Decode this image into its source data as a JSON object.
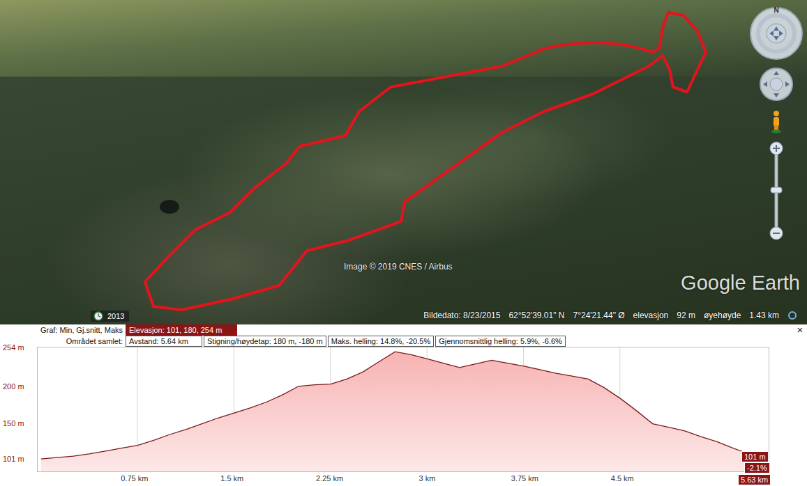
{
  "map": {
    "attribution": "Image © 2019 CNES / Airbus",
    "logo": "Google Earth",
    "compass": "N",
    "timeline_year": "2013",
    "status": {
      "image_date": "Bildedato: 8/23/2015",
      "lat": "62°52'39.01\" N",
      "lon": "7°24'21.44\" Ø",
      "elevation_label": "elevasjon",
      "elevation": "92 m",
      "eye_label": "øyehøyde",
      "eye_alt": "1.43 km"
    }
  },
  "profile_panel": {
    "close": "×",
    "graph_label": "Graf: Min, Gj.snitt, Maks",
    "elevation_summary": "Elevasjon: 101, 180, 254 m",
    "area_label": "Området samlet:",
    "stats": [
      "Avstand: 5.64 km",
      "Stigning/høydetap: 180 m, -180 m",
      "Maks. helling: 14.8%, -20.5%",
      "Gjennomsnittlig helling: 5.9%, -6.6%"
    ],
    "chart": {
      "km_max": 5.63,
      "y_ticks": [
        {
          "label": "254 m",
          "value": 254
        },
        {
          "label": "200 m",
          "value": 200
        },
        {
          "label": "150 m",
          "value": 150
        },
        {
          "label": "101 m",
          "value": 101
        }
      ],
      "x_ticks": [
        {
          "label": "0.75 km",
          "km": 0.75
        },
        {
          "label": "1.5 km",
          "km": 1.5
        },
        {
          "label": "2.25 km",
          "km": 2.25
        },
        {
          "label": "3 km",
          "km": 3
        },
        {
          "label": "3.75 km",
          "km": 3.75
        },
        {
          "label": "4.5 km",
          "km": 4.5
        }
      ],
      "series": [
        {
          "name": "Elevasjon",
          "values": [
            101,
            103,
            105,
            108,
            112,
            116,
            120,
            127,
            135,
            142,
            150,
            158,
            165,
            172,
            180,
            190,
            202,
            204,
            205,
            212,
            222,
            236,
            250,
            246,
            240,
            234,
            228,
            233,
            238,
            234,
            230,
            225,
            220,
            216,
            212,
            200,
            185,
            168,
            150,
            145,
            140,
            132,
            125,
            116,
            108,
            101
          ]
        }
      ],
      "end_markers": {
        "elevation": "101 m",
        "slope": "-2.1%",
        "distance": "5.63 km"
      }
    }
  }
}
